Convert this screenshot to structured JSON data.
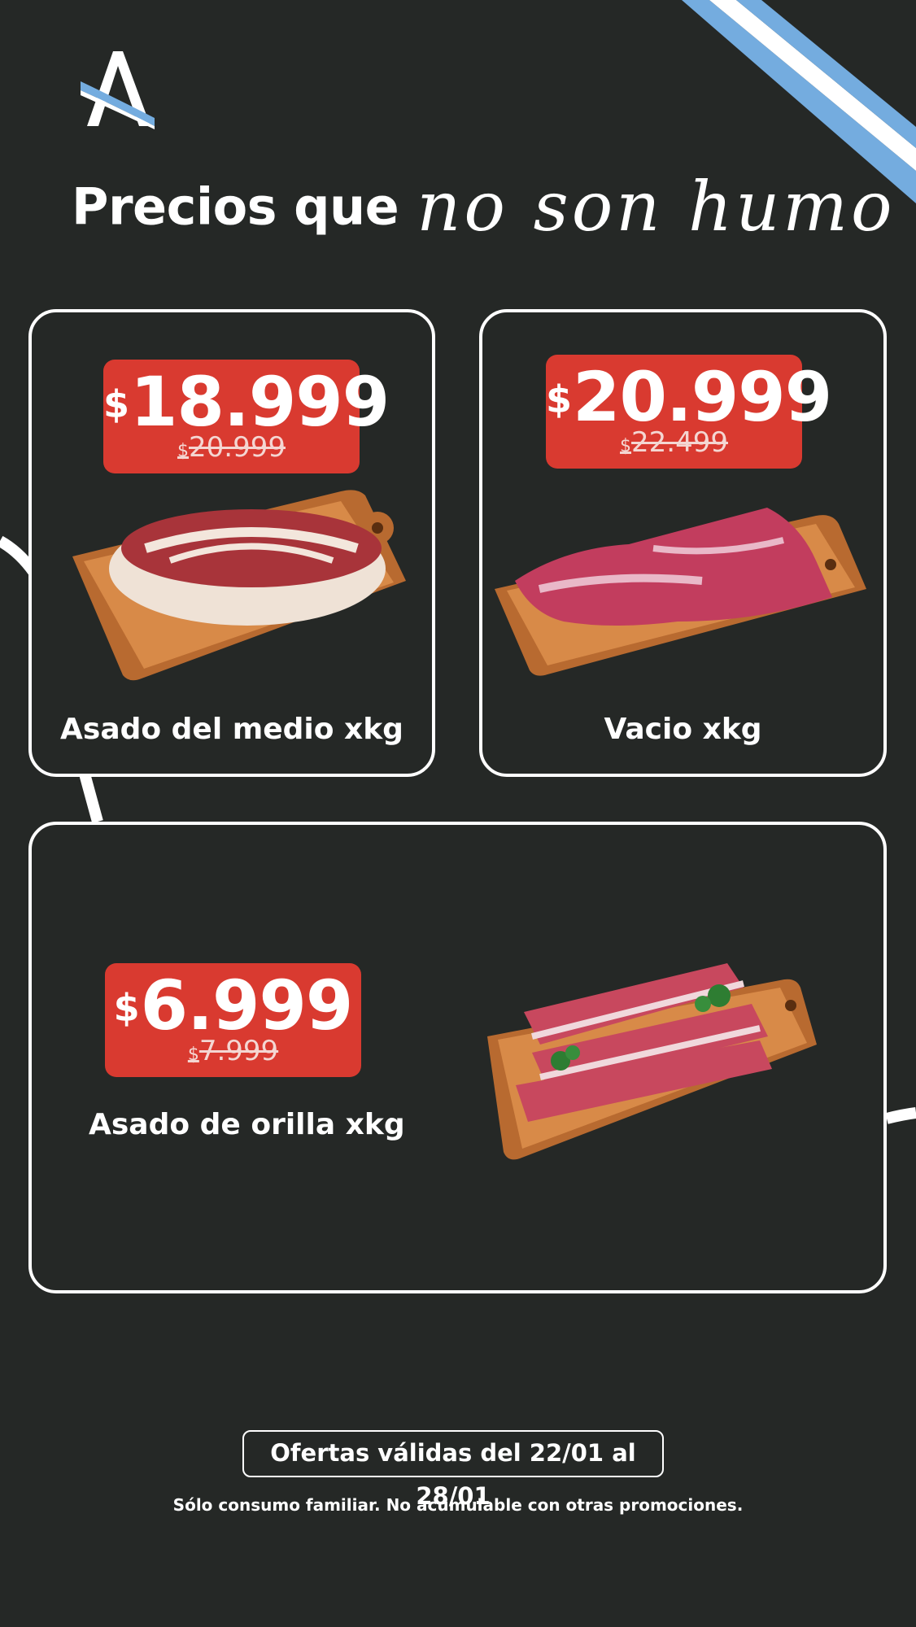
{
  "headline": {
    "plain": "Precios que",
    "script": "no son humo"
  },
  "products": [
    {
      "price": "18.999",
      "was": "20.999",
      "currency": "$",
      "name": "Asado del medio xkg"
    },
    {
      "price": "20.999",
      "was": "22.499",
      "currency": "$",
      "name": "Vacio xkg"
    },
    {
      "price": "6.999",
      "was": "7.999",
      "currency": "$",
      "name": "Asado de orilla xkg"
    }
  ],
  "footer": {
    "validity": "Ofertas válidas del 22/01 al 28/01",
    "disclaimer": "Sólo consumo familiar. No acumulable con otras promociones."
  },
  "colors": {
    "background": "#252826",
    "price_tag": "#d93a30",
    "flag_blue": "#74acdf",
    "board": "#c6783a"
  }
}
